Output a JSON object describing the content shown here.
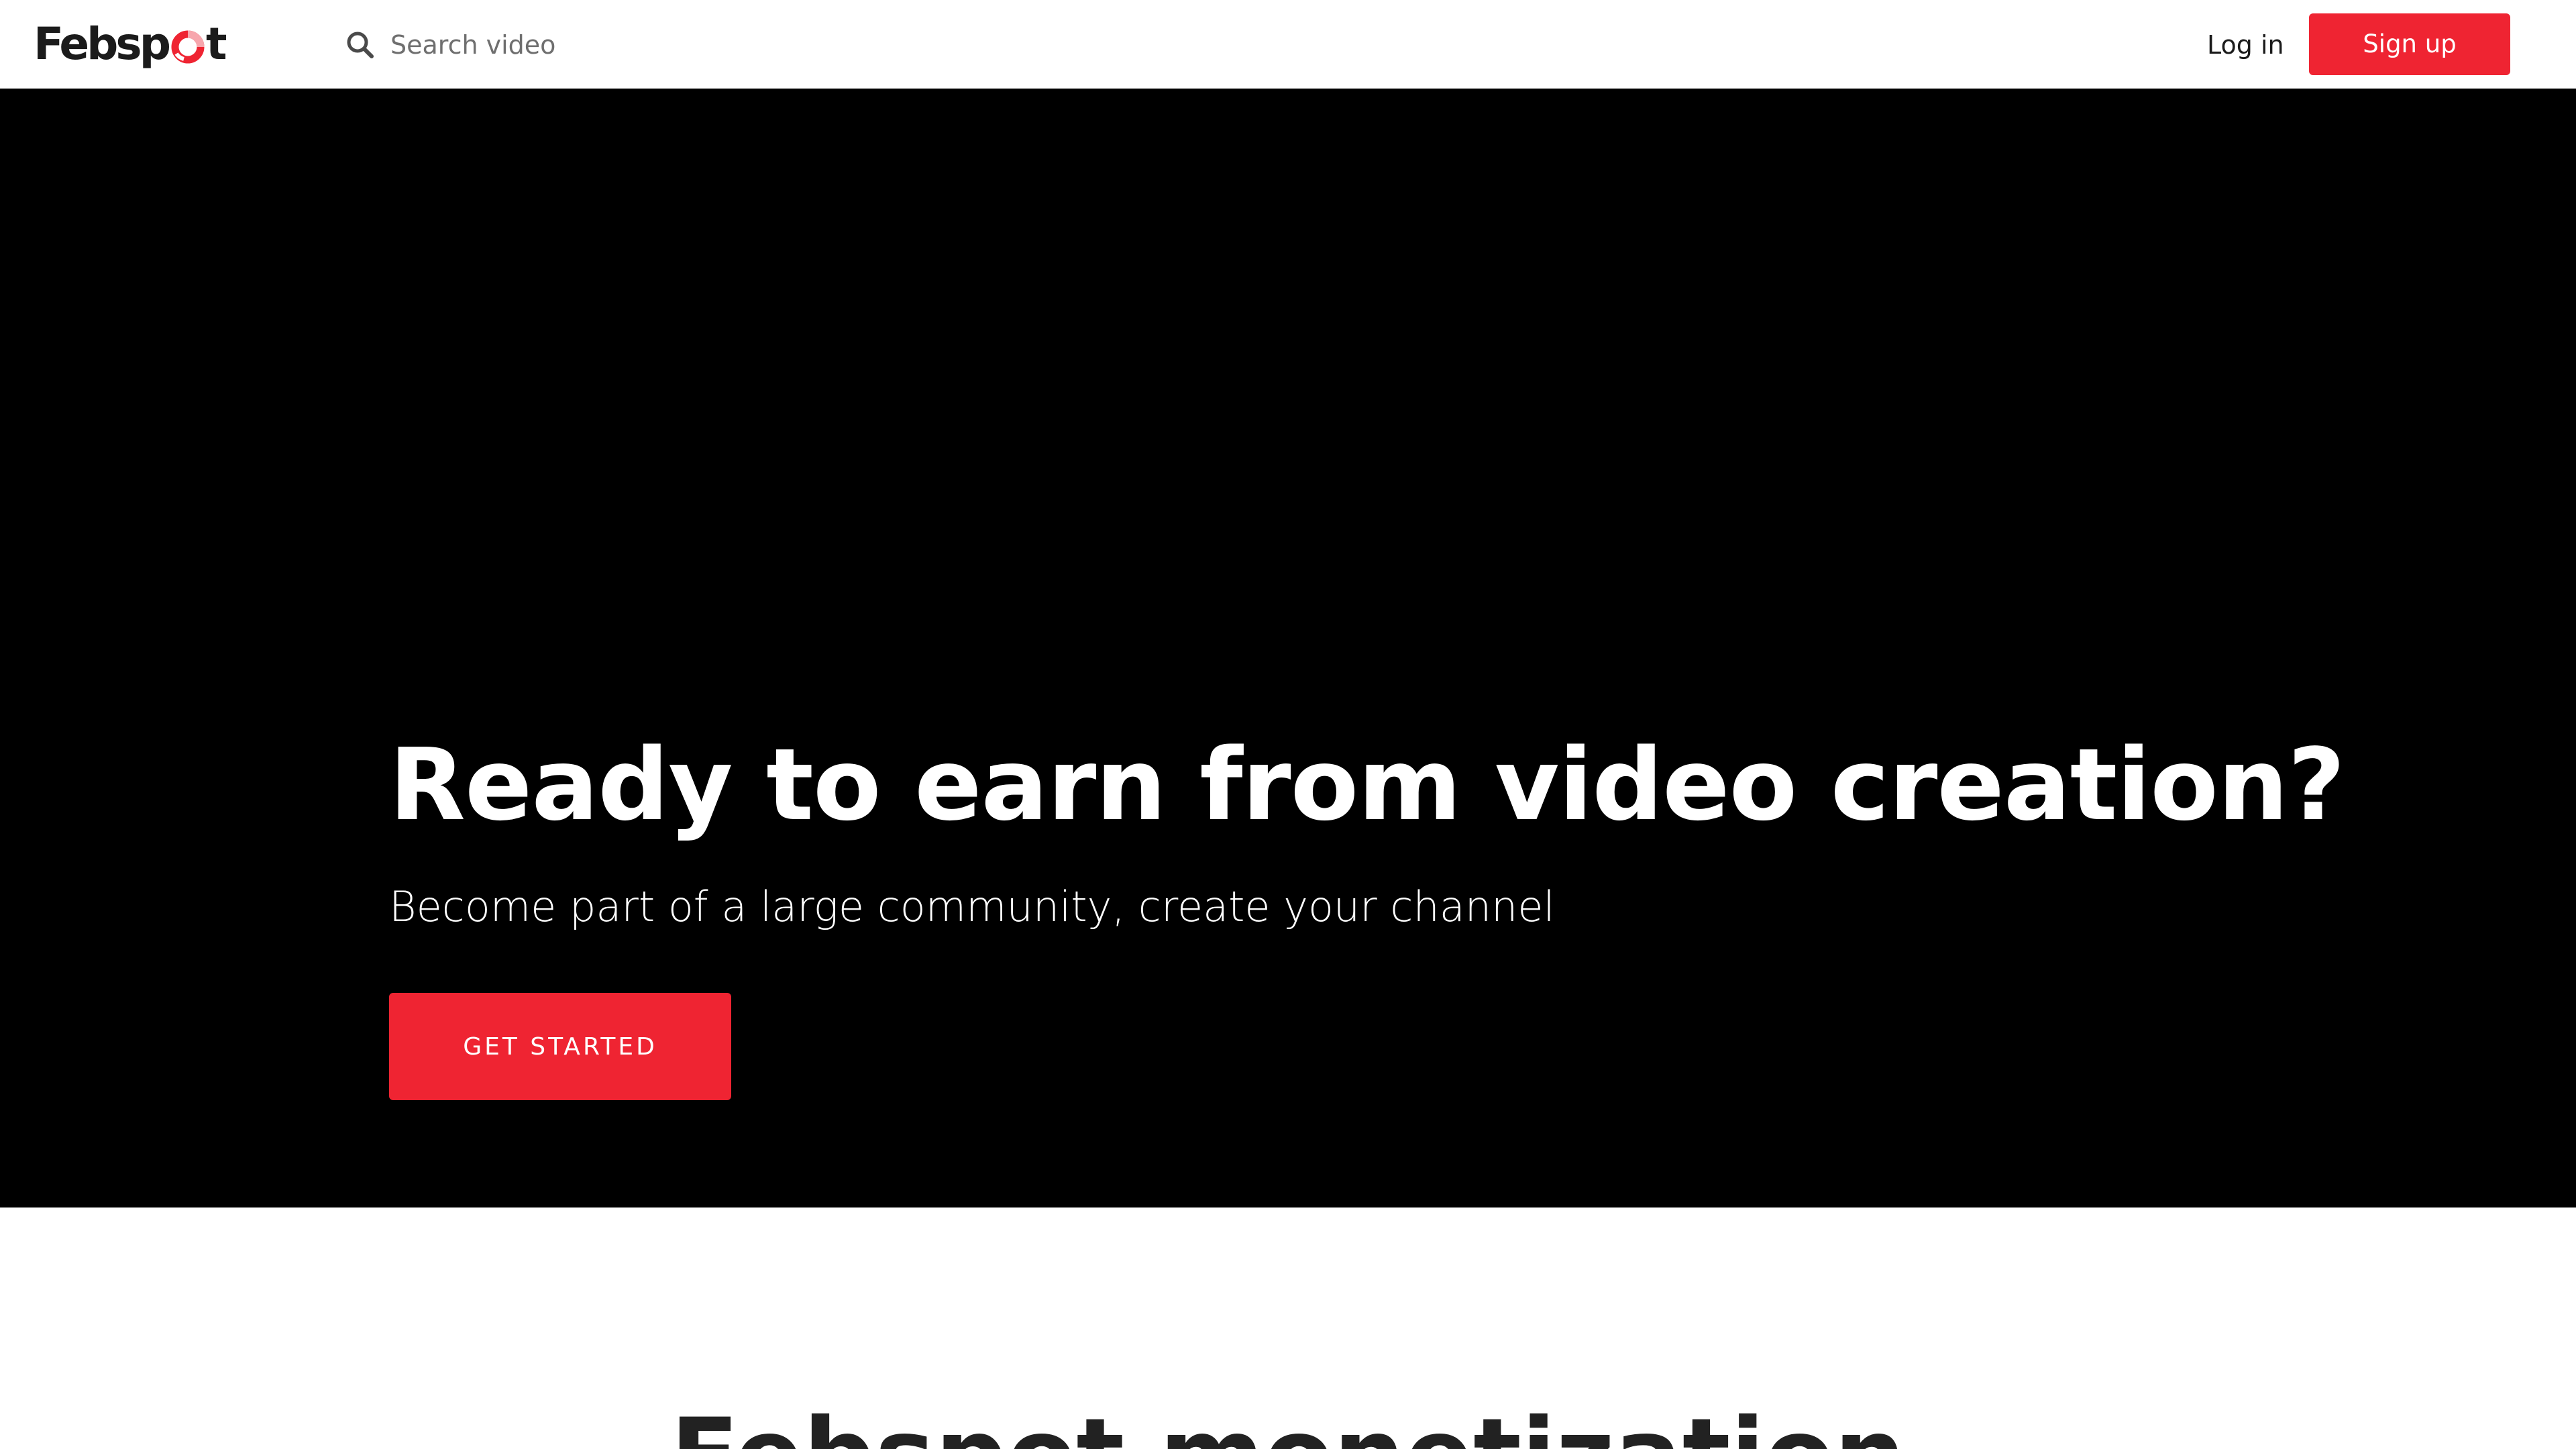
{
  "header": {
    "logo": {
      "text_start": "Febsp",
      "text_end": "t",
      "brand_color": "#ef2432"
    },
    "search": {
      "icon": "search-icon",
      "placeholder": "Search video"
    },
    "login_label": "Log in",
    "signup_label": "Sign up"
  },
  "hero": {
    "title": "Ready to earn from video creation?",
    "subtitle": "Become part of a large community, create your channel",
    "cta_label": "GET STARTED",
    "background": "#000000",
    "accent": "#ef2432"
  },
  "section": {
    "title": "Febspot monetization"
  }
}
